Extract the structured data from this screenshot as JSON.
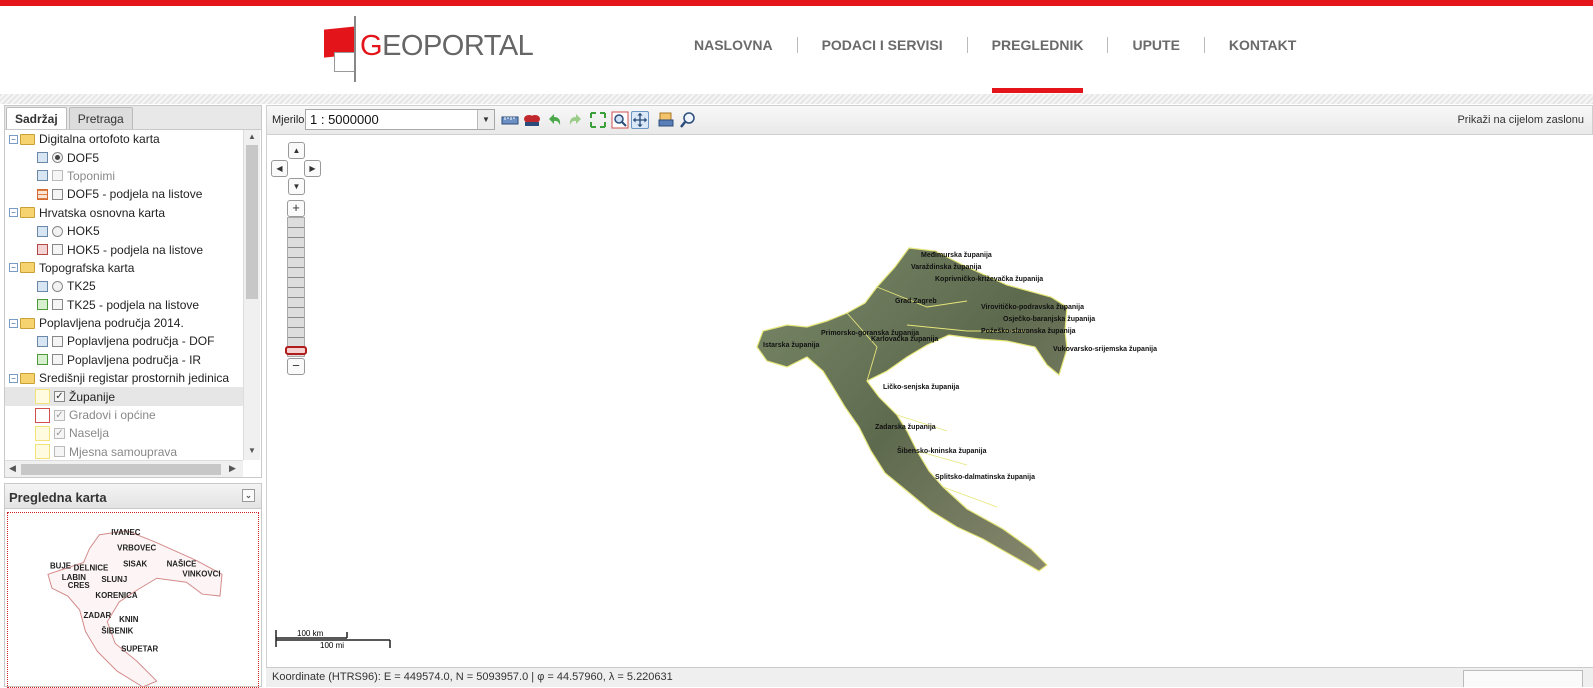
{
  "logo": {
    "first_letter": "G",
    "rest": "EOPORTAL"
  },
  "nav": [
    "NASLOVNA",
    "PODACI I SERVISI",
    "PREGLEDNIK",
    "UPUTE",
    "KONTAKT"
  ],
  "nav_active": "PREGLEDNIK",
  "left_tabs": [
    "Sadržaj",
    "Pretraga"
  ],
  "tree": [
    {
      "type": "group",
      "label": "Digitalna ortofoto karta"
    },
    {
      "type": "layer",
      "icon": "map-layer-icon",
      "control": "radio-on",
      "label": "DOF5"
    },
    {
      "type": "layer",
      "icon": "map-layer-icon",
      "control": "checkbox-dim",
      "label": "Toponimi",
      "dim": true
    },
    {
      "type": "layer",
      "icon": "sheet-grid-icon",
      "control": "checkbox",
      "label": "DOF5 - podjela na listove"
    },
    {
      "type": "group",
      "label": "Hrvatska osnovna karta"
    },
    {
      "type": "layer",
      "icon": "map-layer-icon",
      "control": "radio",
      "label": "HOK5"
    },
    {
      "type": "layer",
      "icon": "sheet-grid-red-icon",
      "control": "checkbox",
      "label": "HOK5 - podjela na listove"
    },
    {
      "type": "group",
      "label": "Topografska karta"
    },
    {
      "type": "layer",
      "icon": "map-layer-icon",
      "control": "radio",
      "label": "TK25"
    },
    {
      "type": "layer",
      "icon": "sheet-grid-green-icon",
      "control": "checkbox",
      "label": "TK25 - podjela na listove"
    },
    {
      "type": "group",
      "label": "Poplavljena područja 2014."
    },
    {
      "type": "layer",
      "icon": "map-layer-icon",
      "control": "checkbox",
      "label": "Poplavljena područja - DOF"
    },
    {
      "type": "layer",
      "icon": "sheet-grid-green-icon",
      "control": "checkbox",
      "label": "Poplavljena područja - IR"
    },
    {
      "type": "group",
      "label": "Središnji registar prostornih jedinica"
    },
    {
      "type": "layer",
      "icon": "yellow-boundary-icon",
      "control": "checked",
      "label": "Županije",
      "selected": true
    },
    {
      "type": "layer",
      "icon": "red-boundary-icon",
      "control": "checked-dim",
      "label": "Gradovi i općine",
      "dim": true
    },
    {
      "type": "layer",
      "icon": "yellow-boundary-icon",
      "control": "checked-dim",
      "label": "Naselja",
      "dim": true
    },
    {
      "type": "layer",
      "icon": "blank-icon",
      "control": "checkbox-dim",
      "label": "Mjesna samouprava",
      "dim": true
    }
  ],
  "overview": {
    "title": "Pregledna karta",
    "towns": [
      "IVANEC",
      "VRBOVEC",
      "BUJE",
      "DELNICE",
      "SISAK",
      "NAŠICE",
      "VINKOVCI",
      "LABIN",
      "SLUNJ",
      "CRES",
      "KORENICA",
      "ZADAR",
      "KNIN",
      "ŠIBENIK",
      "SUPETAR"
    ]
  },
  "toolbar": {
    "scale_label": "Mjerilo",
    "scale_value": "1 : 5000000",
    "fullscreen": "Prikaži na cijelom zaslonu"
  },
  "map": {
    "counties": [
      "Međimurska županija",
      "Varaždinska županija",
      "Koprivničko-križevačka županija",
      "Grad Zagreb",
      "Virovitičko-podravska županija",
      "Osječko-baranjska županija",
      "Požeško-slavonska županija",
      "Primorsko-goranska županija",
      "Karlovačka županija",
      "Istarska županija",
      "Vukovarsko-srijemska županija",
      "Ličko-senjska županija",
      "Zadarska županija",
      "Šibensko-kninska županija",
      "Splitsko-dalmatinska županija"
    ],
    "scalebar_km": "100 km",
    "scalebar_mi": "100 mi"
  },
  "statusbar": "Koordinate (HTRS96): E = 449574.0, N = 5093957.0 | φ = 44.57960, λ = 5.220631",
  "colors": {
    "accent": "#e3151a"
  }
}
